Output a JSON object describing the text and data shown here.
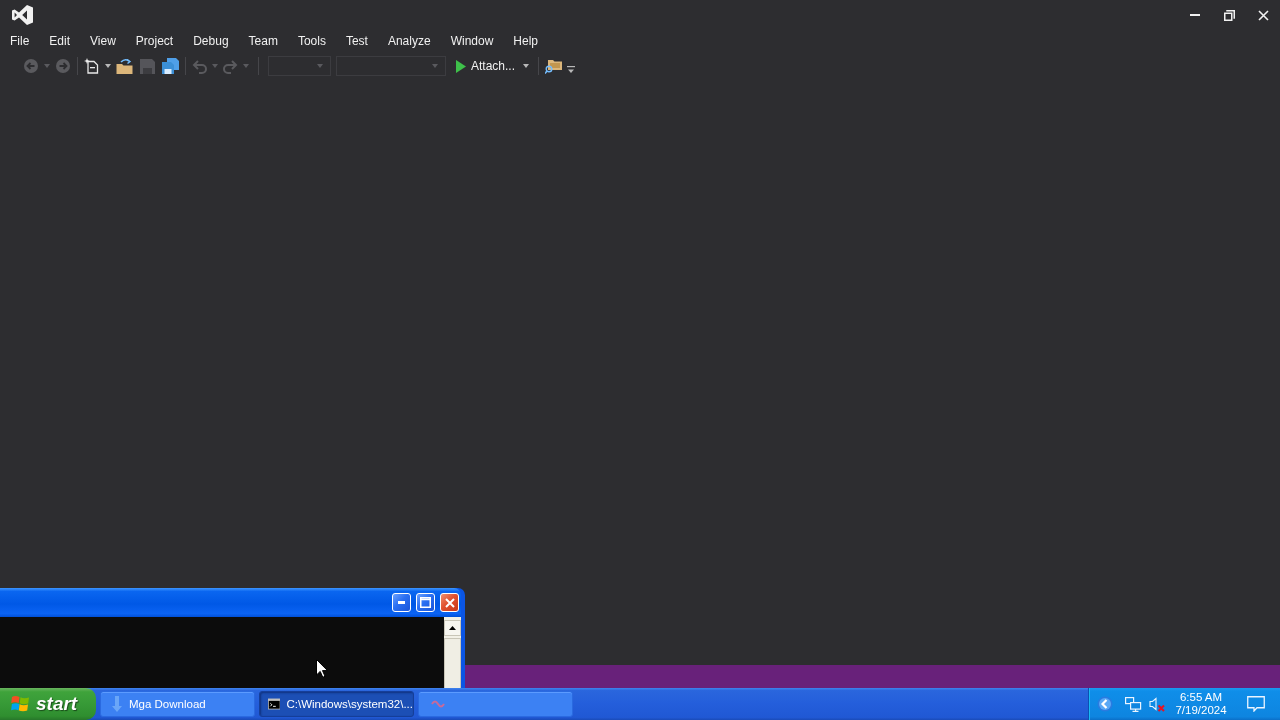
{
  "menu_bar": {
    "items": [
      "File",
      "Edit",
      "View",
      "Project",
      "Debug",
      "Team",
      "Tools",
      "Test",
      "Analyze",
      "Window",
      "Help"
    ]
  },
  "toolbar": {
    "navigate_backward": {
      "disabled": true
    },
    "navigate_forward": {
      "disabled": true
    },
    "new_project": {
      "disabled": false
    },
    "open_file": {
      "disabled": false
    },
    "save": {
      "disabled": true
    },
    "save_all": {
      "disabled": false
    },
    "undo": {
      "disabled": true
    },
    "redo": {
      "disabled": true
    },
    "configuration": {
      "disabled": true
    },
    "platform": {
      "disabled": true
    },
    "start": {
      "label": "Attach..."
    }
  },
  "taskbar": {
    "start_label": "start",
    "tasks": [
      {
        "label": "Mga Download",
        "selected": false
      },
      {
        "label": "C:\\Windows\\system32\\...",
        "selected": true
      },
      {
        "selected": false
      }
    ],
    "tray": {
      "volume_muted": true,
      "time": "6:55 AM",
      "date": "7/19/2024"
    }
  }
}
